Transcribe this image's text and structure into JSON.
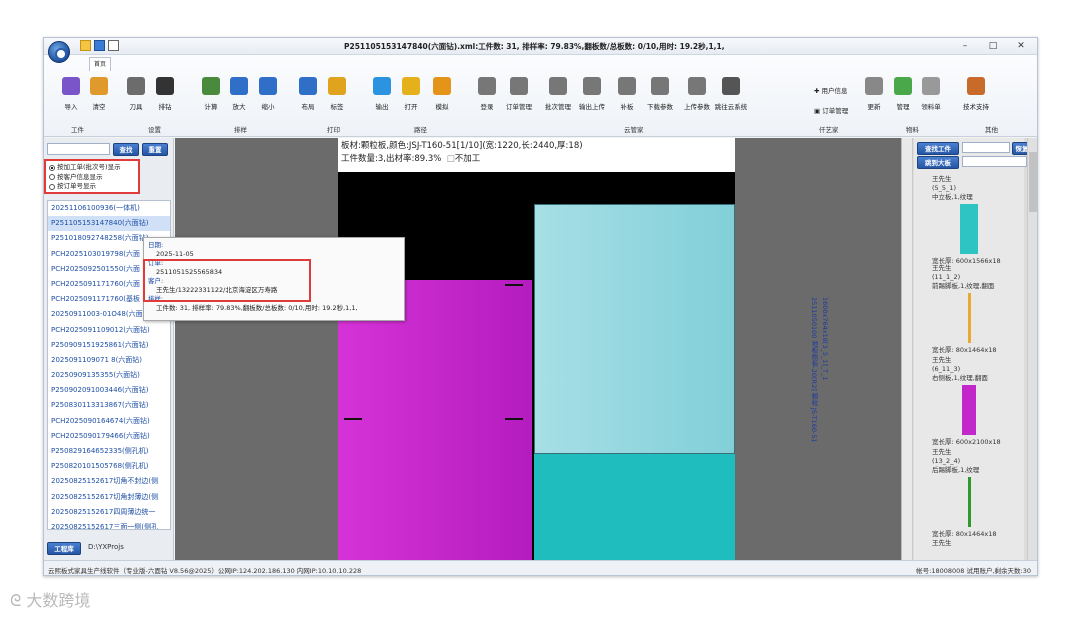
{
  "window": {
    "title": "P251105153147840(六面钻).xml:工件数: 31, 排样率: 79.83%,翻板数/总板数: 0/10,用时: 19.2秒,1,1,",
    "ribbon_tab": "首页"
  },
  "ribbon": {
    "buttons": [
      {
        "id": "import",
        "label": "导入",
        "color": "#7a55c9"
      },
      {
        "id": "clear",
        "label": "清空",
        "color": "#e09a2b"
      },
      {
        "id": "tools",
        "label": "刀具",
        "color": "#6c6c6c"
      },
      {
        "id": "drill",
        "label": "排钻",
        "color": "#333333"
      },
      {
        "id": "calc",
        "label": "计算",
        "color": "#4a8a3d"
      },
      {
        "id": "zoomin",
        "label": "放大",
        "color": "#2f6fc7"
      },
      {
        "id": "zoomout",
        "label": "缩小",
        "color": "#2f6fc7"
      },
      {
        "id": "layout",
        "label": "布局",
        "color": "#2f6fc7"
      },
      {
        "id": "tag",
        "label": "标签",
        "color": "#e0a31e"
      },
      {
        "id": "export",
        "label": "输出",
        "color": "#2c93e0"
      },
      {
        "id": "open",
        "label": "打开",
        "color": "#e4b11d"
      },
      {
        "id": "simulate",
        "label": "模拟",
        "color": "#e39419"
      },
      {
        "id": "login",
        "label": "登录",
        "color": "#777777"
      },
      {
        "id": "order",
        "label": "订单管理",
        "color": "#777777"
      },
      {
        "id": "batch",
        "label": "批次管理",
        "color": "#777777"
      },
      {
        "id": "upload",
        "label": "输出上传",
        "color": "#777777"
      },
      {
        "id": "patch",
        "label": "补板",
        "color": "#777777"
      },
      {
        "id": "dlparam",
        "label": "下载参数",
        "color": "#777777"
      },
      {
        "id": "ulparam",
        "label": "上传参数",
        "color": "#777777"
      },
      {
        "id": "cloud",
        "label": "跳往云系统",
        "color": "#555555"
      },
      {
        "id": "update",
        "label": "更新",
        "color": "#888888"
      },
      {
        "id": "manage",
        "label": "管理",
        "color": "#4aa84a"
      },
      {
        "id": "material",
        "label": "领料单",
        "color": "#999999"
      },
      {
        "id": "support",
        "label": "技术支持",
        "color": "#c86a2a"
      }
    ],
    "small_buttons": {
      "user_info": "用户信息",
      "order_manage": "订单管理"
    },
    "groups": [
      {
        "label": "工件"
      },
      {
        "label": "设置"
      },
      {
        "label": "排样"
      },
      {
        "label": "打印"
      },
      {
        "label": "路径"
      },
      {
        "label": "云管家"
      },
      {
        "label": "仟艺家"
      },
      {
        "label": "物料"
      },
      {
        "label": "其他"
      }
    ]
  },
  "left": {
    "search_value": "",
    "find_label": "查找",
    "reset_label": "重置",
    "radios": [
      {
        "label": "按加工单(批次号)显示",
        "checked": true
      },
      {
        "label": "按客户信息显示",
        "checked": false
      },
      {
        "label": "按订单号显示",
        "checked": false
      }
    ],
    "items": [
      "20251106100936(一体机)",
      "P251105153147840(六面钻)",
      "P251018092748258(六面钻)",
      "PCH2025103019798(六面",
      "PCH2025092501550(六面",
      "PCH2025091171760(六面",
      "PCH2025091171760(基板",
      "20250911003-01O48(六面",
      "PCH2025091109012(六面钻)",
      "P250909151925861(六面钻)",
      "2025091109071 8(六面钻)",
      "20250909135355(六面钻)",
      "P250902091003446(六面钻)",
      "P250830113313867(六面钻)",
      "PCH2025090164674(六面钻)",
      "PCH2025090179466(六面钻)",
      "P250829164652335(侧孔机)",
      "P250820101505768(侧孔机)",
      "20250825152617切角不封边(侧",
      "20250825152617切角封薄边(侧",
      "20250825152617四周薄边统一",
      "20250825152617三面一侧(侧孔"
    ],
    "project_button": "工程库",
    "project_path": "D:\\YXProjs"
  },
  "canvas": {
    "header_line1": "板材:颗粒板,颜色:JSJ-T160-51[1/10](宽:1220,长:2440,厚:18)",
    "header_line2": "工件数量:3,出材率:89.3%",
    "no_process": "不加工",
    "vertical_text_1": "1600x764x18[3_5_1]_T_1",
    "vertical_text_2": "2511050100 地柜侧板-20[R2]  颗粒 JS-T160-51"
  },
  "tooltip": {
    "date_label": "日期:",
    "date_value": "2025-11-05",
    "order_label": "订单:",
    "order_value": "2511051525565834",
    "customer_label": "客户:",
    "customer_value": "王先生/13222331122/北京海淀区万寿路",
    "layout_label": "排样:",
    "layout_value": "工件数: 31, 排样率: 79.83%,翻板数/总板数: 0/10,用时: 19.2秒,1,1,"
  },
  "right": {
    "find_part": "查找工件",
    "restore": "恢复",
    "jump_board": "跳到大板",
    "parts": [
      {
        "owner": "王先生",
        "code": "(5_5_1)",
        "desc": "中立板,1,纹理",
        "size": "宽长厚: 600x1566x18",
        "color": "#2fc4c4"
      },
      {
        "owner": "王先生",
        "code": "(11_1_2)",
        "desc": "前踢脚板,1,纹理,翻面",
        "size": "宽长厚: 80x1464x18",
        "color": "#e8a935"
      },
      {
        "owner": "王先生",
        "code": "(6_11_3)",
        "desc": "右侧板,1,纹理,翻面",
        "size": "宽长厚: 600x2100x18",
        "color": "#c227c9"
      },
      {
        "owner": "王先生",
        "code": "(13_2_4)",
        "desc": "后踢脚板,1,纹理",
        "size": "宽长厚: 80x1464x18",
        "color": "#2e9a2e"
      }
    ],
    "last_owner": "王先生"
  },
  "status": {
    "left": "云熙板式家具生产线软件（专业版-六面钻 V8.56@2025）公网IP:124.202.186.130 内网IP:10.10.10.228",
    "right": "帐号:18008008 试用账户,剩余天数:30"
  },
  "watermark": "大数跨境"
}
